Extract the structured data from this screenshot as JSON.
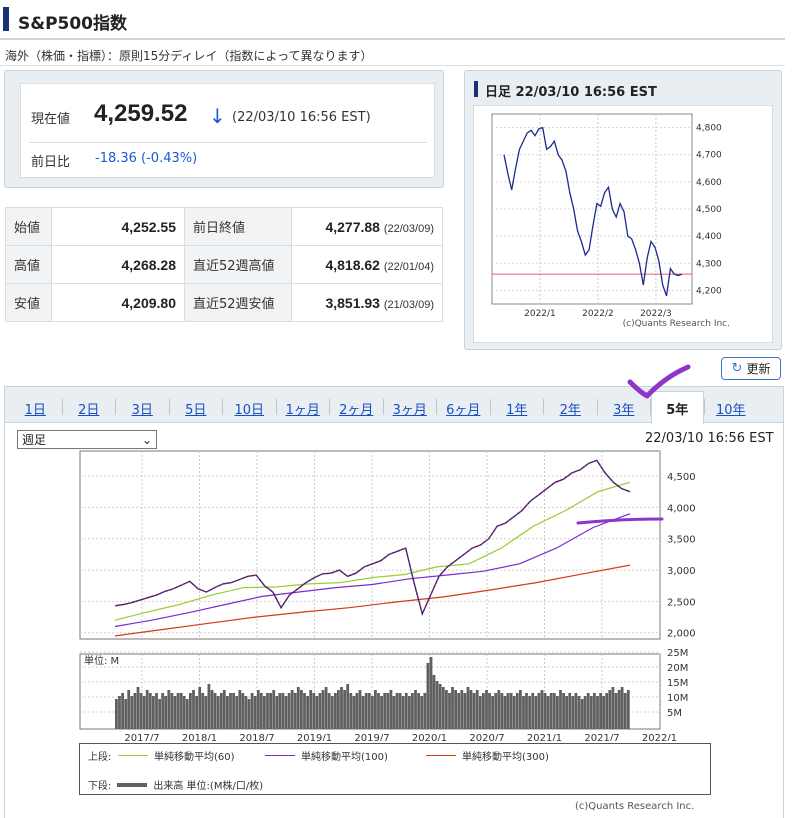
{
  "page": {
    "title": "S&P500指数",
    "delay_note": "海外（株価・指標）：原則15分ディレイ（指数によって異なります）"
  },
  "current": {
    "label": "現在値",
    "value": "4,259.52",
    "arrow": "↓",
    "time": "(22/03/10 16:56 EST)",
    "prev_label": "前日比",
    "change": "-18.36 (-0.43%)",
    "down_color": "#1a5bd4"
  },
  "stats": [
    {
      "label": "始値",
      "value": "4,252.55",
      "label2": "前日終値",
      "value2": "4,277.88",
      "date2": "(22/03/09)"
    },
    {
      "label": "高値",
      "value": "4,268.28",
      "label2": "直近52週高値",
      "value2": "4,818.62",
      "date2": "(22/01/04)"
    },
    {
      "label": "安値",
      "value": "4,209.80",
      "label2": "直近52週安値",
      "value2": "3,851.93",
      "date2": "(21/03/09)"
    }
  ],
  "mini_chart": {
    "title": "日足 22/03/10 16:56 EST",
    "y_ticks": [
      "4,800",
      "4,700",
      "4,600",
      "4,500",
      "4,400",
      "4,300",
      "4,200"
    ],
    "x_ticks": [
      "2022/1",
      "2022/2",
      "2022/3"
    ],
    "copyright": "(c)Quants Research Inc."
  },
  "refresh_label": "更新",
  "tabs": [
    {
      "label": "1日"
    },
    {
      "label": "2日"
    },
    {
      "label": "3日"
    },
    {
      "label": "5日"
    },
    {
      "label": "10日"
    },
    {
      "label": "1ヶ月"
    },
    {
      "label": "2ヶ月"
    },
    {
      "label": "3ヶ月"
    },
    {
      "label": "6ヶ月"
    },
    {
      "label": "1年"
    },
    {
      "label": "2年"
    },
    {
      "label": "3年"
    },
    {
      "label": "5年"
    },
    {
      "label": "10年"
    }
  ],
  "active_tab": "5年",
  "period_select": {
    "value": "週足",
    "arrow": "⌄"
  },
  "chart_time": "22/03/10 16:56 EST",
  "legend": {
    "upper_label": "上段:",
    "ma60": "単純移動平均(60)",
    "ma100": "単純移動平均(100)",
    "ma300": "単純移動平均(300)",
    "lower_label": "下段:",
    "volume": "出来高 単位:(M株/口/枚)",
    "copyright": "(c)Quants Research Inc."
  },
  "colors": {
    "ma60": "#9acd32",
    "ma100": "#7a2bd1",
    "ma300": "#d23b14",
    "price": "#1d2a8a",
    "up": "#e0102a",
    "volume": "#606060",
    "annotation": "#8d36c7"
  },
  "chart_data": [
    {
      "type": "line",
      "title": "日足 22/03/10 16:56 EST",
      "x_ticks": [
        "2022/1",
        "2022/2",
        "2022/3"
      ],
      "ylim": [
        4150,
        4850
      ],
      "series": [
        {
          "values": [
            4700,
            4630,
            4570,
            4650,
            4720,
            4750,
            4780,
            4790,
            4770,
            4795,
            4800,
            4720,
            4730,
            4750,
            4700,
            4680,
            4640,
            4560,
            4500,
            4420,
            4380,
            4330,
            4350,
            4440,
            4520,
            4510,
            4560,
            4580,
            4500,
            4470,
            4520,
            4490,
            4400,
            4390,
            4350,
            4300,
            4220,
            4320,
            4380,
            4360,
            4310,
            4220,
            4180,
            4280,
            4260,
            4255,
            4260
          ]
        }
      ]
    },
    {
      "type": "line",
      "x_ticks": [
        "2017/7",
        "2018/1",
        "2018/7",
        "2019/1",
        "2019/7",
        "2020/1",
        "2020/7",
        "2021/1",
        "2021/7",
        "2022/1"
      ],
      "y_ticks": [
        "4,500",
        "4,000",
        "3,500",
        "3,000",
        "2,500",
        "2,000"
      ],
      "ylim": [
        1900,
        4900
      ],
      "series": [
        {
          "name": "単純移動平均(60)",
          "values": [
            2200,
            2330,
            2450,
            2600,
            2720,
            2730,
            2780,
            2800,
            2880,
            2930,
            3050,
            3100,
            3350,
            3700,
            3950,
            4250,
            4400
          ]
        },
        {
          "name": "単純移動平均(100)",
          "values": [
            2100,
            2200,
            2320,
            2450,
            2580,
            2650,
            2720,
            2770,
            2860,
            2920,
            2980,
            3100,
            3350,
            3680,
            3900
          ]
        },
        {
          "name": "単純移動平均(300)",
          "values": [
            1950,
            2050,
            2150,
            2250,
            2330,
            2400,
            2490,
            2570,
            2680,
            2800,
            2940,
            3080
          ]
        }
      ]
    },
    {
      "type": "bar",
      "ylabel": "単位: M",
      "y_ticks": [
        "25M",
        "20M",
        "15M",
        "10M",
        "5M"
      ],
      "ylim": [
        0,
        25
      ],
      "values": [
        10,
        11,
        12,
        10,
        13,
        11,
        12,
        14,
        12,
        11,
        13,
        12,
        11,
        12,
        10,
        12,
        11,
        13,
        12,
        11,
        12,
        12,
        11,
        10,
        12,
        13,
        11,
        14,
        12,
        11,
        15,
        13,
        12,
        11,
        12,
        13,
        11,
        12,
        12,
        11,
        13,
        12,
        11,
        10,
        12,
        11,
        13,
        12,
        11,
        12,
        12,
        13,
        11,
        12,
        12,
        11,
        12,
        13,
        12,
        14,
        13,
        12,
        11,
        13,
        12,
        11,
        12,
        13,
        14,
        12,
        11,
        12,
        13,
        14,
        13,
        15,
        12,
        11,
        12,
        13,
        11,
        12,
        12,
        11,
        13,
        12,
        11,
        12,
        12,
        13,
        11,
        12,
        12,
        11,
        12,
        11,
        12,
        13,
        12,
        11,
        12,
        22,
        24,
        18,
        16,
        15,
        14,
        13,
        12,
        14,
        13,
        12,
        13,
        12,
        14,
        13,
        12,
        13,
        11,
        12,
        13,
        12,
        11,
        12,
        13,
        12,
        11,
        12,
        12,
        11,
        12,
        13,
        11,
        12,
        11,
        12,
        11,
        12,
        13,
        12,
        11,
        12,
        12,
        11,
        13,
        12,
        11,
        12,
        11,
        12,
        11,
        10,
        11,
        12,
        11,
        12,
        11,
        12,
        11,
        12,
        13,
        14,
        12,
        13,
        14,
        12,
        13
      ]
    }
  ]
}
